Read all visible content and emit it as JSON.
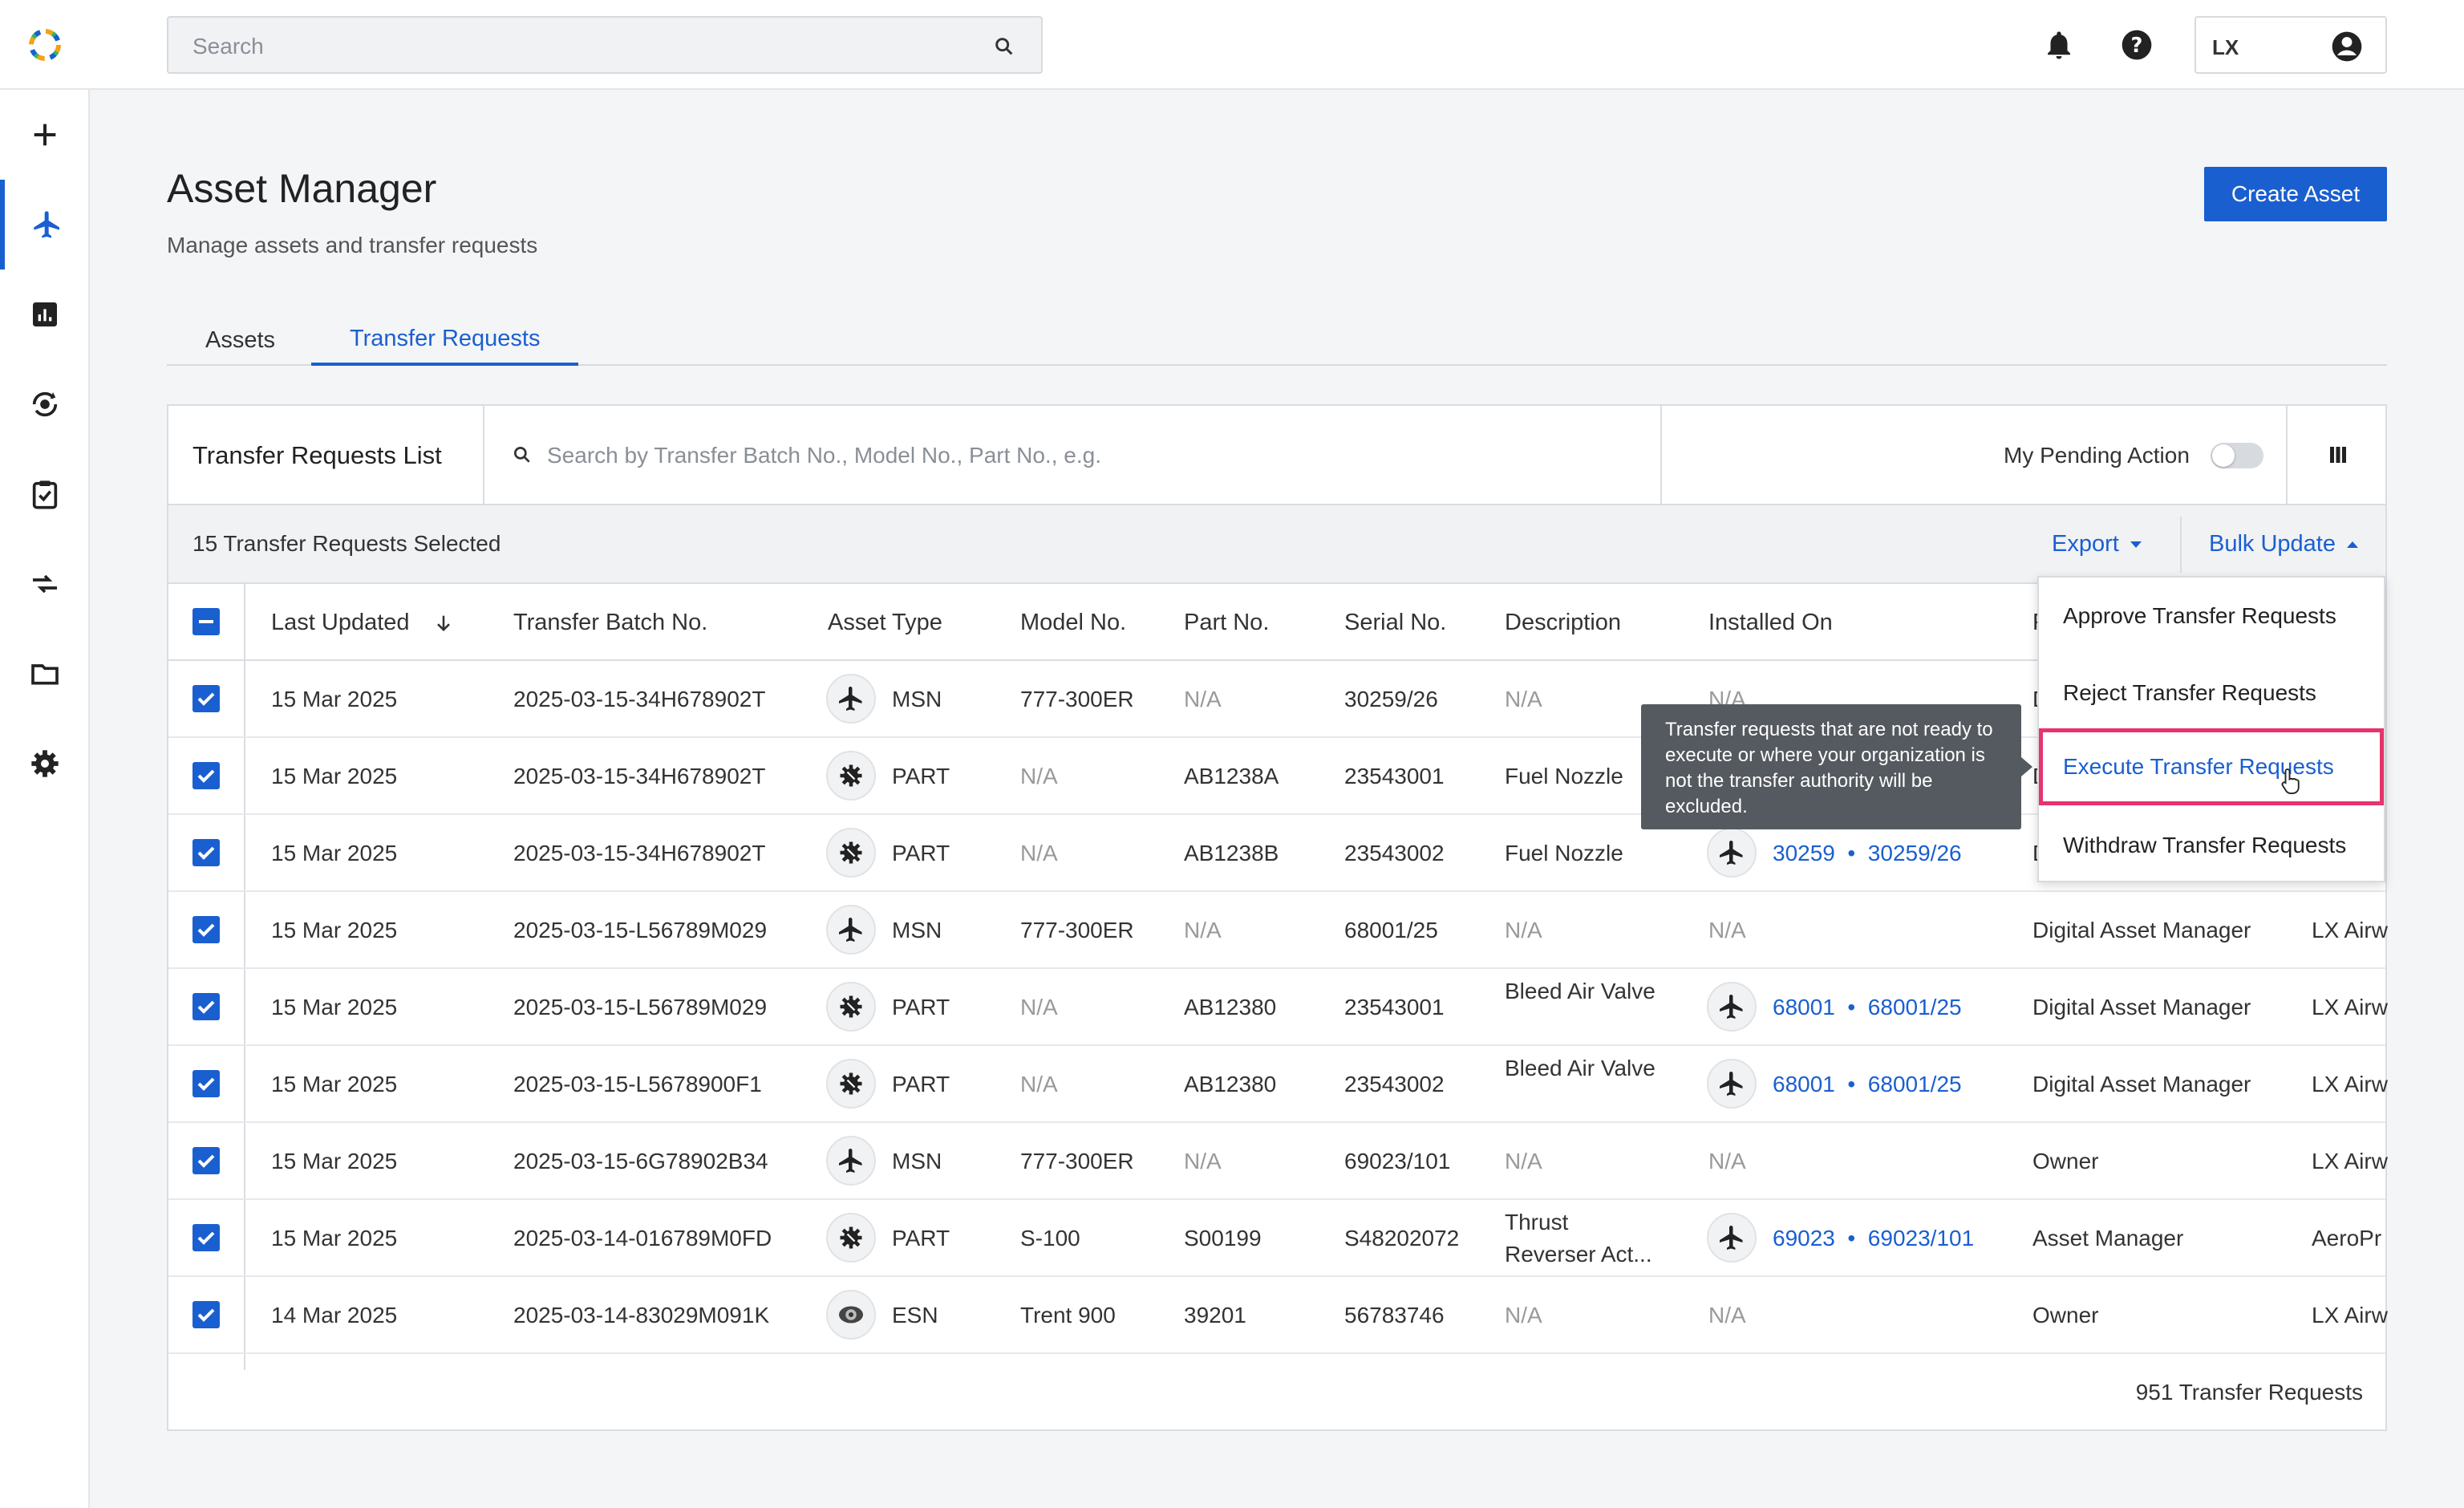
{
  "header": {
    "search_placeholder": "Search",
    "user_code": "LX"
  },
  "sidebar": {
    "items": [
      {
        "icon": "plus-icon"
      },
      {
        "icon": "airplane-icon",
        "active": true
      },
      {
        "icon": "chart-icon"
      },
      {
        "icon": "transfer-cycle-icon"
      },
      {
        "icon": "clipboard-check-icon"
      },
      {
        "icon": "swap-arrows-icon"
      },
      {
        "icon": "folder-icon"
      },
      {
        "icon": "gear-icon"
      }
    ]
  },
  "page": {
    "title": "Asset Manager",
    "subtitle": "Manage assets and transfer requests",
    "create_button": "Create Asset"
  },
  "tabs": [
    {
      "label": "Assets"
    },
    {
      "label": "Transfer Requests",
      "active": true
    }
  ],
  "list": {
    "title": "Transfer Requests List",
    "search_placeholder": "Search by Transfer Batch No., Model No., Part No., e.g.",
    "pending_label": "My Pending Action",
    "selected_text": "15 Transfer Requests Selected",
    "export_label": "Export",
    "bulk_update_label": "Bulk Update",
    "footer_count": "951 Transfer Requests"
  },
  "columns": {
    "last_updated": "Last Updated",
    "batch": "Transfer Batch No.",
    "asset_type": "Asset Type",
    "model": "Model No.",
    "part": "Part No.",
    "serial": "Serial No.",
    "description": "Description",
    "installed_on": "Installed On",
    "col9_partial": "F"
  },
  "rows": [
    {
      "date": "15 Mar 2025",
      "batch": "2025-03-15-34H678902T",
      "type": "MSN",
      "model": "777-300ER",
      "part": "N/A",
      "serial": "30259/26",
      "desc": "N/A",
      "inst_a": "",
      "inst_b": "",
      "inst_na": "N/A",
      "role": "D",
      "org": ""
    },
    {
      "date": "15 Mar 2025",
      "batch": "2025-03-15-34H678902T",
      "type": "PART",
      "model": "N/A",
      "part": "AB1238A",
      "serial": "23543001",
      "desc": "Fuel Nozzle",
      "inst_a": "",
      "inst_b": "",
      "inst_na": "",
      "role": "D",
      "org": ""
    },
    {
      "date": "15 Mar 2025",
      "batch": "2025-03-15-34H678902T",
      "type": "PART",
      "model": "N/A",
      "part": "AB1238B",
      "serial": "23543002",
      "desc": "Fuel Nozzle",
      "inst_a": "30259",
      "inst_b": "30259/26",
      "inst_na": "",
      "role": "D",
      "org": ""
    },
    {
      "date": "15 Mar 2025",
      "batch": "2025-03-15-L56789M029",
      "type": "MSN",
      "model": "777-300ER",
      "part": "N/A",
      "serial": "68001/25",
      "desc": "N/A",
      "inst_a": "",
      "inst_b": "",
      "inst_na": "N/A",
      "role": "Digital Asset Manager",
      "org": "LX Airw"
    },
    {
      "date": "15 Mar 2025",
      "batch": "2025-03-15-L56789M029",
      "type": "PART",
      "model": "N/A",
      "part": "AB12380",
      "serial": "23543001",
      "desc": "Bleed Air Valve",
      "inst_a": "68001",
      "inst_b": "68001/25",
      "inst_na": "",
      "role": "Digital Asset Manager",
      "org": "LX Airw"
    },
    {
      "date": "15 Mar 2025",
      "batch": "2025-03-15-L5678900F1",
      "type": "PART",
      "model": "N/A",
      "part": "AB12380",
      "serial": "23543002",
      "desc": "Bleed Air Valve",
      "inst_a": "68001",
      "inst_b": "68001/25",
      "inst_na": "",
      "role": "Digital Asset Manager",
      "org": "LX Airw"
    },
    {
      "date": "15 Mar 2025",
      "batch": "2025-03-15-6G78902B34",
      "type": "MSN",
      "model": "777-300ER",
      "part": "N/A",
      "serial": "69023/101",
      "desc": "N/A",
      "inst_a": "",
      "inst_b": "",
      "inst_na": "N/A",
      "role": "Owner",
      "org": "LX Airw"
    },
    {
      "date": "15 Mar 2025",
      "batch": "2025-03-14-016789M0FD",
      "type": "PART",
      "model": "S-100",
      "part": "S00199",
      "serial": "S48202072",
      "desc": "Thrust Reverser Act...",
      "inst_a": "69023",
      "inst_b": "69023/101",
      "inst_na": "",
      "role": "Asset Manager",
      "org": "AeroPr"
    },
    {
      "date": "14 Mar 2025",
      "batch": "2025-03-14-83029M091K",
      "type": "ESN",
      "model": "Trent 900",
      "part": "39201",
      "serial": "56783746",
      "desc": "N/A",
      "inst_a": "",
      "inst_b": "",
      "inst_na": "N/A",
      "role": "Owner",
      "org": "LX Airw"
    }
  ],
  "bulk_menu": {
    "items": [
      {
        "label": "Approve Transfer Requests"
      },
      {
        "label": "Reject Transfer Requests"
      },
      {
        "label": "Execute Transfer Requests",
        "highlighted": true
      },
      {
        "label": "Withdraw Transfer Requests"
      }
    ]
  },
  "tooltip": {
    "text": "Transfer requests that are not ready to execute or where your organization is not the transfer authority will be excluded."
  },
  "colors": {
    "accent": "#1a5fd0",
    "highlight_border": "#e8336d",
    "tooltip_bg": "#555a60"
  }
}
